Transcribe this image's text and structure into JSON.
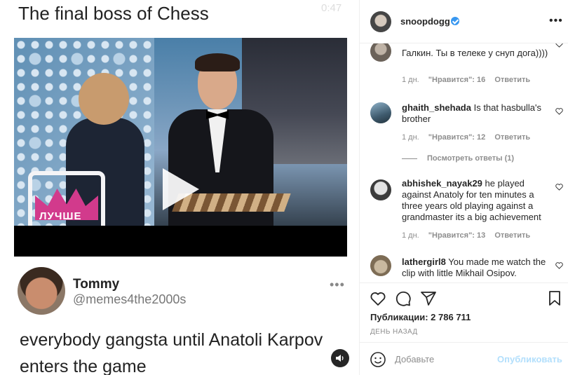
{
  "post": {
    "title": "The final boss of Chess",
    "timer": "0:47",
    "tweet": {
      "name": "Tommy",
      "handle": "@memes4the2000s",
      "more": "•••",
      "text": "everybody gangsta until Anatoli Karpov enters the game"
    },
    "video_logo": "ЛУЧШЕ"
  },
  "header": {
    "username": "snoopdogg",
    "verified": true,
    "more": "•••"
  },
  "comments": [
    {
      "username": "",
      "text": "Галкин. Ты в телеке у снуп дога))))",
      "time": "1 дн.",
      "likes": "\"Нравится\": 16",
      "reply": "Ответить"
    },
    {
      "username": "ghaith_shehada",
      "text": "Is that hasbulla's brother",
      "time": "1 дн.",
      "likes": "\"Нравится\": 12",
      "reply": "Ответить",
      "view_replies": "Посмотреть ответы (1)"
    },
    {
      "username": "abhishek_nayak29",
      "text": "he played against Anatoly for ten minutes a three years old playing against a grandmaster its a big achievement",
      "time": "1 дн.",
      "likes": "\"Нравится\": 13",
      "reply": "Ответить"
    },
    {
      "username": "lathergirl8",
      "text": "You made me watch the clip with little Mikhail Osipov.",
      "time": "",
      "likes": "",
      "reply": ""
    }
  ],
  "actions": {
    "likes": "Публикации: 2 786 711",
    "date": "ДЕНЬ НАЗАД"
  },
  "add_comment": {
    "placeholder": "Добавьте",
    "publish": "Опубликовать"
  },
  "colors": {
    "verified": "#3897f0",
    "publish_disabled": "#b2dffc",
    "meta_gray": "#8e8e8e"
  }
}
